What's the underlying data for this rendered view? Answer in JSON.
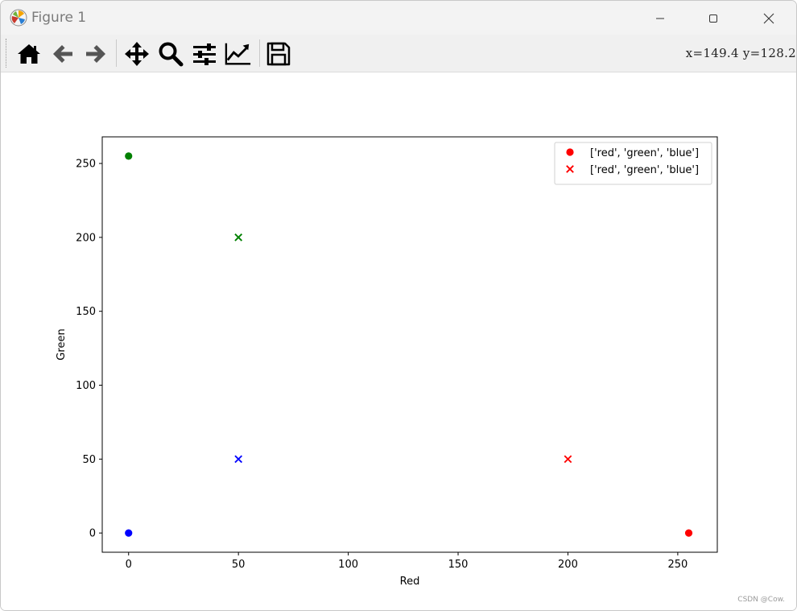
{
  "window": {
    "title": "Figure 1",
    "coords_readout": "x=149.4  y=128.2"
  },
  "toolbar": {
    "tools": [
      {
        "name": "home-icon"
      },
      {
        "name": "back-arrow-icon"
      },
      {
        "name": "forward-arrow-icon"
      },
      {
        "name": "pan-icon"
      },
      {
        "name": "zoom-icon"
      },
      {
        "name": "configure-subplots-icon"
      },
      {
        "name": "edit-axis-icon"
      },
      {
        "name": "save-icon"
      }
    ]
  },
  "chart_data": {
    "type": "scatter",
    "xlabel": "Red",
    "ylabel": "Green",
    "xlim": [
      -12,
      268
    ],
    "ylim": [
      -13,
      268
    ],
    "xticks": [
      0,
      50,
      100,
      150,
      200,
      250
    ],
    "yticks": [
      0,
      50,
      100,
      150,
      200,
      250
    ],
    "grid": false,
    "legend_position": "top-right",
    "series": [
      {
        "name": "['red', 'green', 'blue']",
        "marker": "o",
        "points": [
          {
            "x": 255,
            "y": 0,
            "color": "#ff0000"
          },
          {
            "x": 0,
            "y": 255,
            "color": "#008000"
          },
          {
            "x": 0,
            "y": 0,
            "color": "#0000ff"
          }
        ]
      },
      {
        "name": "['red', 'green', 'blue']",
        "marker": "x",
        "points": [
          {
            "x": 200,
            "y": 50,
            "color": "#ff0000"
          },
          {
            "x": 50,
            "y": 200,
            "color": "#008000"
          },
          {
            "x": 50,
            "y": 50,
            "color": "#0000ff"
          }
        ]
      }
    ],
    "legend_marker_color": "#ff0000"
  },
  "watermark": "CSDN @Cow."
}
